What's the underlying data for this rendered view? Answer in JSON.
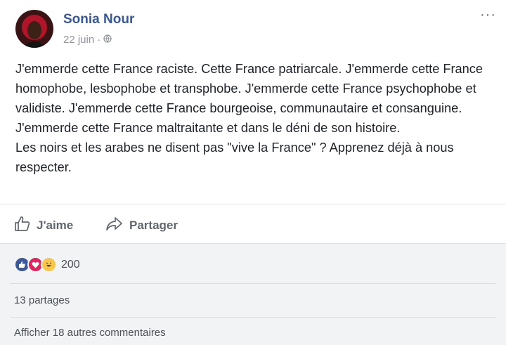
{
  "post": {
    "author": "Sonia Nour",
    "date": "22 juin",
    "separator": "·",
    "more_label": "···",
    "paragraphs": [
      "J'emmerde cette France raciste. Cette France patriarcale. J'emmerde cette France homophobe, lesbophobe et transphobe. J'emmerde cette France psychophobe et validiste. J'emmerde cette France bourgeoise, communautaire et consanguine. J'emmerde cette France maltraitante et dans le déni de son histoire.",
      "Les noirs et les arabes ne disent pas \"vive la France\" ? Apprenez déjà à nous respecter."
    ]
  },
  "actions": {
    "like_label": "J'aime",
    "share_label": "Partager"
  },
  "feedback": {
    "reaction_icons": [
      "like-icon",
      "love-icon",
      "haha-icon"
    ],
    "reaction_count": "200",
    "shares": "13 partages",
    "view_more_comments": "Afficher 18 autres commentaires"
  },
  "colors": {
    "author_link": "#365899",
    "like_blue": "#3b5998",
    "love_red": "#e0245e",
    "haha_yellow": "#f7c64a"
  }
}
